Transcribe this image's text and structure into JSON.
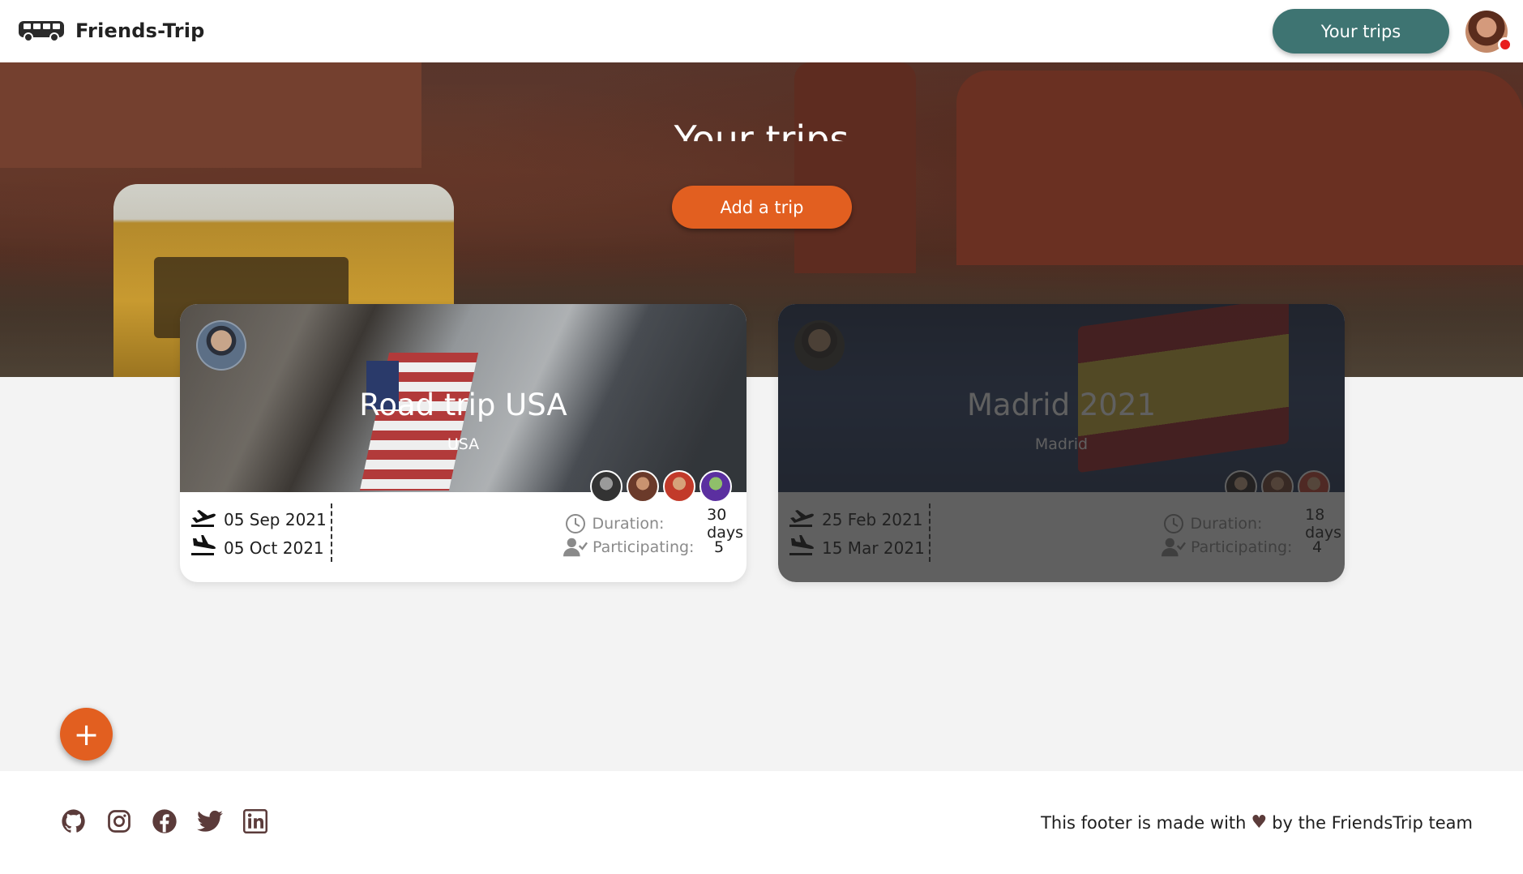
{
  "navbar": {
    "brand": "Friends-Trip",
    "trips_button": "Your trips"
  },
  "hero": {
    "title": "Your trips",
    "add_trip_button": "Add a trip"
  },
  "trips": [
    {
      "title": "Road trip USA",
      "location": "USA",
      "start_date": "05 Sep 2021",
      "end_date": "05 Oct 2021",
      "duration_label": "Duration:",
      "duration_value": "30 days",
      "participating_label": "Participating:",
      "participating_value": "5",
      "participant_avatars": 4
    },
    {
      "title": "Madrid 2021",
      "location": "Madrid",
      "start_date": "25 Feb 2021",
      "end_date": "15 Mar 2021",
      "duration_label": "Duration:",
      "duration_value": "18 days",
      "participating_label": "Participating:",
      "participating_value": "4",
      "participant_avatars": 3
    }
  ],
  "fab": {
    "label": "+"
  },
  "footer": {
    "social_icons": [
      "github-icon",
      "instagram-icon",
      "facebook-icon",
      "twitter-icon",
      "linkedin-icon"
    ],
    "text_before": "This footer is made with",
    "text_after": "by the FriendsTrip team"
  },
  "colors": {
    "primary": "#3e7472",
    "accent": "#e25f20",
    "footer_icon": "#5b3b3a"
  }
}
